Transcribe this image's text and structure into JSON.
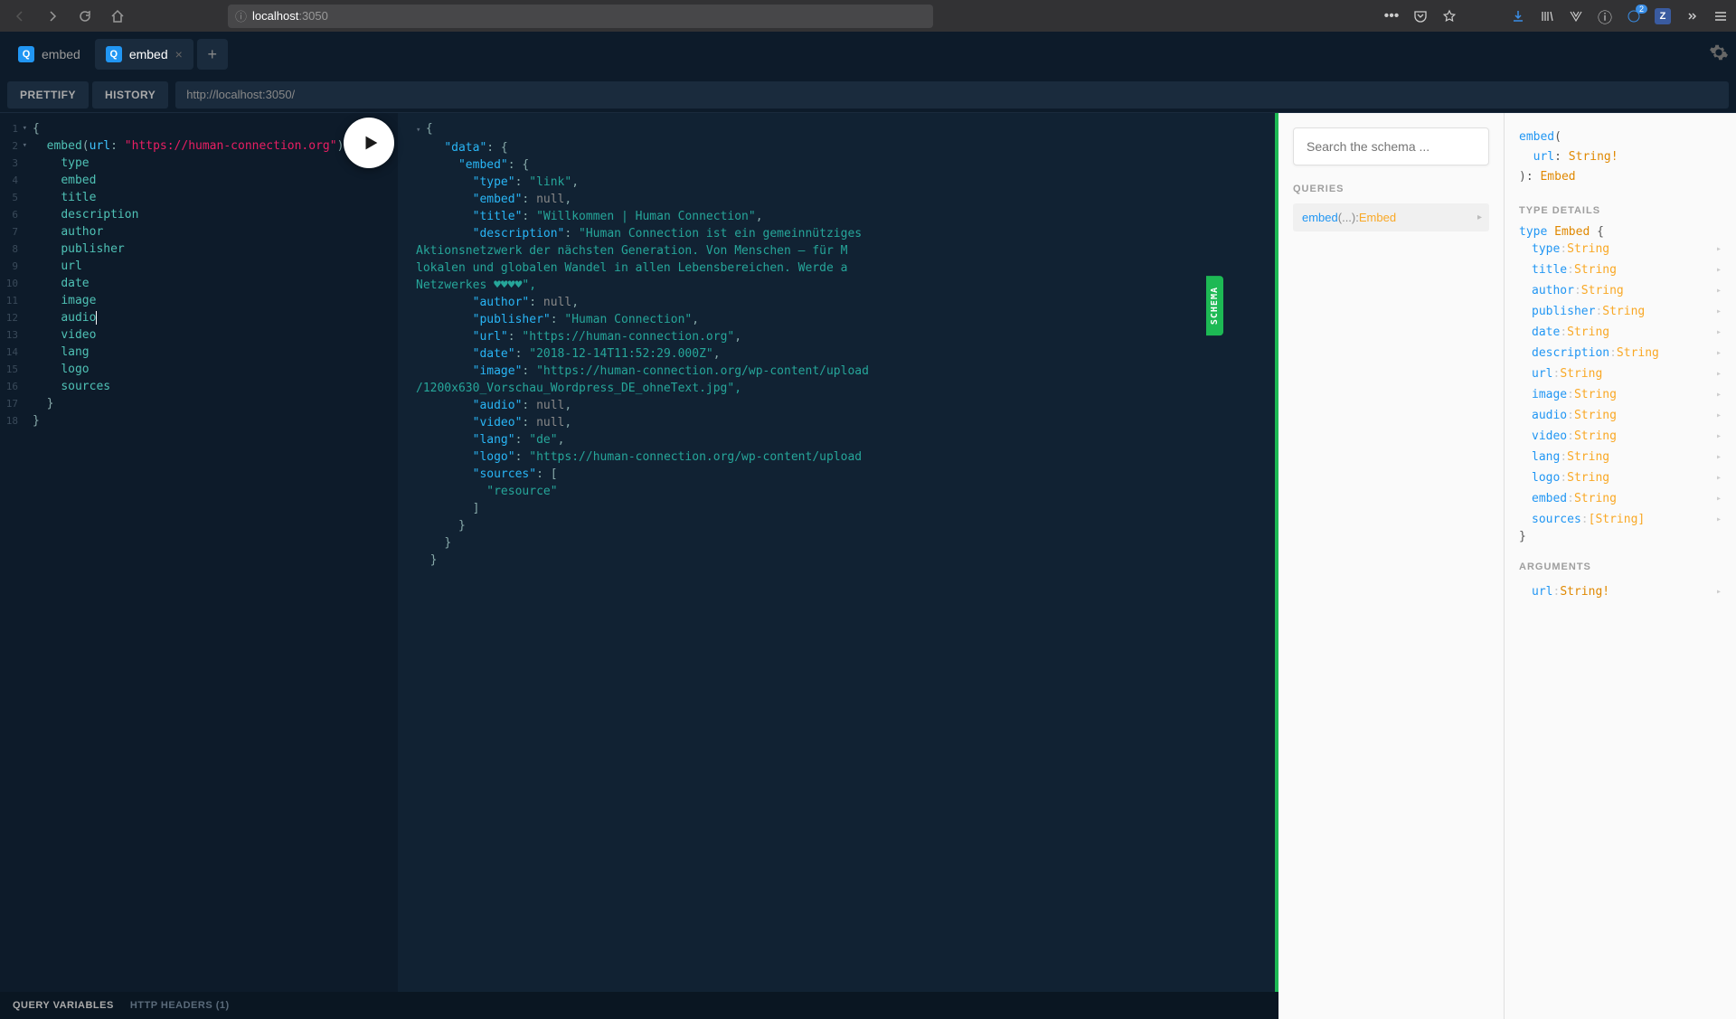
{
  "browser": {
    "url_host": "localhost",
    "url_path": ":3050",
    "ellipsis": "•••",
    "badge_count": "2",
    "z_label": "Z"
  },
  "tabs": [
    {
      "label": "embed",
      "active": false
    },
    {
      "label": "embed",
      "active": true
    }
  ],
  "toolbar": {
    "prettify": "PRETTIFY",
    "history": "HISTORY",
    "endpoint": "http://localhost:3050/"
  },
  "editor": {
    "line_numbers": [
      "1",
      "2",
      "3",
      "4",
      "5",
      "6",
      "7",
      "8",
      "9",
      "10",
      "11",
      "12",
      "13",
      "14",
      "15",
      "16",
      "17",
      "18"
    ],
    "query": {
      "fn": "embed",
      "arg": "url",
      "arg_value": "\"https://human-connection.org\"",
      "fields": [
        "type",
        "embed",
        "title",
        "description",
        "author",
        "publisher",
        "url",
        "date",
        "image",
        "audio",
        "video",
        "lang",
        "logo",
        "sources"
      ]
    }
  },
  "result": {
    "data_key": "\"data\"",
    "embed_key": "\"embed\"",
    "fields": {
      "type": {
        "k": "\"type\"",
        "v": "\"link\"",
        "comma": ","
      },
      "embed": {
        "k": "\"embed\"",
        "v": "null",
        "comma": ","
      },
      "title": {
        "k": "\"title\"",
        "v": "\"Willkommen | Human Connection\"",
        "comma": ","
      },
      "description": {
        "k": "\"description\"",
        "v": "\"Human Connection ist ein gemeinnütziges",
        "cont1": "Aktionsnetzwerk der nächsten Generation. Von Menschen – für M",
        "cont2": "lokalen und globalen Wandel in allen Lebensbereichen. Werde a",
        "cont3": "Netzwerkes ♥♥♥♥\","
      },
      "author": {
        "k": "\"author\"",
        "v": "null",
        "comma": ","
      },
      "publisher": {
        "k": "\"publisher\"",
        "v": "\"Human Connection\"",
        "comma": ","
      },
      "url": {
        "k": "\"url\"",
        "v": "\"https://human-connection.org\"",
        "comma": ","
      },
      "date": {
        "k": "\"date\"",
        "v": "\"2018-12-14T11:52:29.000Z\"",
        "comma": ","
      },
      "image": {
        "k": "\"image\"",
        "v": "\"https://human-connection.org/wp-content/upload",
        "cont": "/1200x630_Vorschau_Wordpress_DE_ohneText.jpg\","
      },
      "audio": {
        "k": "\"audio\"",
        "v": "null",
        "comma": ","
      },
      "video": {
        "k": "\"video\"",
        "v": "null",
        "comma": ","
      },
      "lang": {
        "k": "\"lang\"",
        "v": "\"de\"",
        "comma": ","
      },
      "logo": {
        "k": "\"logo\"",
        "v": "\"https://human-connection.org/wp-content/upload"
      },
      "sources": {
        "k": "\"sources\"",
        "v": "[",
        "item": "\"resource\"",
        "close": "]"
      }
    }
  },
  "schema_tab": "SCHEMA",
  "schema": {
    "search_placeholder": "Search the schema ...",
    "queries_heading": "QUERIES",
    "query_item": {
      "name": "embed",
      "args": "(...): ",
      "type": "Embed"
    },
    "signature": {
      "name": "embed",
      "open": "(",
      "arg": "url",
      "colon": ": ",
      "argtype": "String!",
      "close": "): ",
      "returntype": "Embed"
    },
    "type_details_heading": "TYPE DETAILS",
    "type_decl": {
      "kw": "type ",
      "name": "Embed",
      "open": " {"
    },
    "fields": [
      {
        "name": "type",
        "type": "String"
      },
      {
        "name": "title",
        "type": "String"
      },
      {
        "name": "author",
        "type": "String"
      },
      {
        "name": "publisher",
        "type": "String"
      },
      {
        "name": "date",
        "type": "String"
      },
      {
        "name": "description",
        "type": "String"
      },
      {
        "name": "url",
        "type": "String"
      },
      {
        "name": "image",
        "type": "String"
      },
      {
        "name": "audio",
        "type": "String"
      },
      {
        "name": "video",
        "type": "String"
      },
      {
        "name": "lang",
        "type": "String"
      },
      {
        "name": "logo",
        "type": "String"
      },
      {
        "name": "embed",
        "type": "String"
      },
      {
        "name": "sources",
        "type": "[String]"
      }
    ],
    "type_close": "}",
    "arguments_heading": "ARGUMENTS",
    "argument": {
      "name": "url",
      "type": "String!"
    }
  },
  "bottom": {
    "query_vars": "QUERY VARIABLES",
    "http_headers": "HTTP HEADERS (1)"
  }
}
